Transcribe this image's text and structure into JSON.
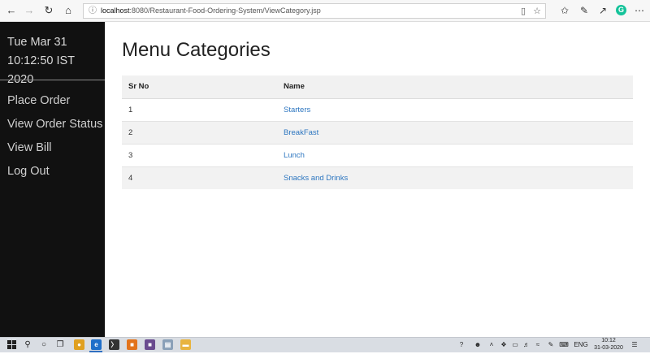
{
  "browser": {
    "url_host": "localhost",
    "url_rest": ":8080/Restaurant-Food-Ordering-System/ViewCategory.jsp"
  },
  "sidebar": {
    "date": "Tue Mar 31",
    "time": "10:12:50 IST 2020",
    "items": [
      {
        "label": "Place Order"
      },
      {
        "label": "View Order Status"
      },
      {
        "label": "View Bill"
      },
      {
        "label": "Log Out"
      }
    ]
  },
  "main": {
    "title": "Menu Categories",
    "table": {
      "headers": [
        "Sr No",
        "Name"
      ],
      "rows": [
        {
          "sr": "1",
          "name": "Starters"
        },
        {
          "sr": "2",
          "name": "BreakFast"
        },
        {
          "sr": "3",
          "name": "Lunch"
        },
        {
          "sr": "4",
          "name": "Snacks and Drinks"
        }
      ]
    }
  },
  "taskbar": {
    "language": "ENG",
    "clock_time": "10:12",
    "clock_date": "31-03-2020"
  },
  "colors": {
    "sidebar_bg": "#111111",
    "link": "#2d76c0",
    "row_alt": "#f2f2f2"
  }
}
